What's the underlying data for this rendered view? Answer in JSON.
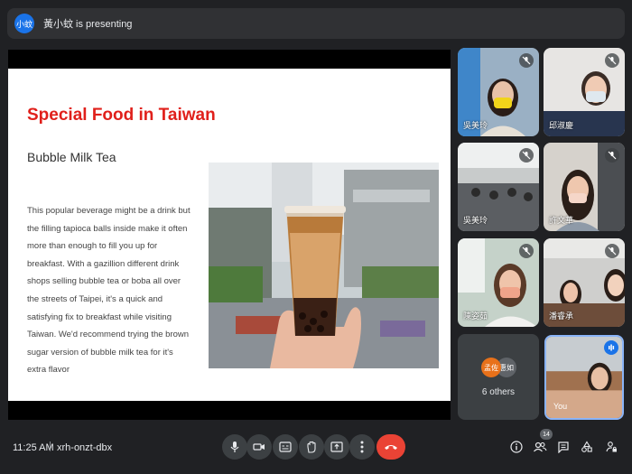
{
  "banner": {
    "avatar_text": "小蚊",
    "presenting_text": "黃小蚊 is presenting"
  },
  "slide": {
    "title": "Special Food in Taiwan",
    "subtitle": "Bubble Milk Tea",
    "body": "This popular beverage might be a drink but the filling tapioca balls inside make it often more than enough to fill you up for breakfast. With a gazillion different drink shops selling bubble tea or boba all over the streets of Taipei, it's a quick and satisfying fix to breakfast while visiting Taiwan. We'd recommend trying the brown sugar version of bubble milk tea for it's extra flavor"
  },
  "participants": [
    {
      "name": "吳美玲"
    },
    {
      "name": "邱淑慶"
    },
    {
      "name": "吳美玲"
    },
    {
      "name": "許文華"
    },
    {
      "name": "陳姿茹"
    },
    {
      "name": "潘睿承"
    }
  ],
  "others": {
    "avatar1": "孟佐",
    "avatar2": "惠如",
    "count_label": "6 others"
  },
  "self_tile": {
    "name": "You"
  },
  "bottom": {
    "time": "11:25 AM",
    "separator": "|",
    "meeting_code": "xrh-onzt-dbx",
    "people_count": "14"
  },
  "colors": {
    "accent": "#8ab4f8",
    "end_call": "#ea4335",
    "title_red": "#e0201b",
    "panel": "#3c4043",
    "background": "#202124"
  }
}
